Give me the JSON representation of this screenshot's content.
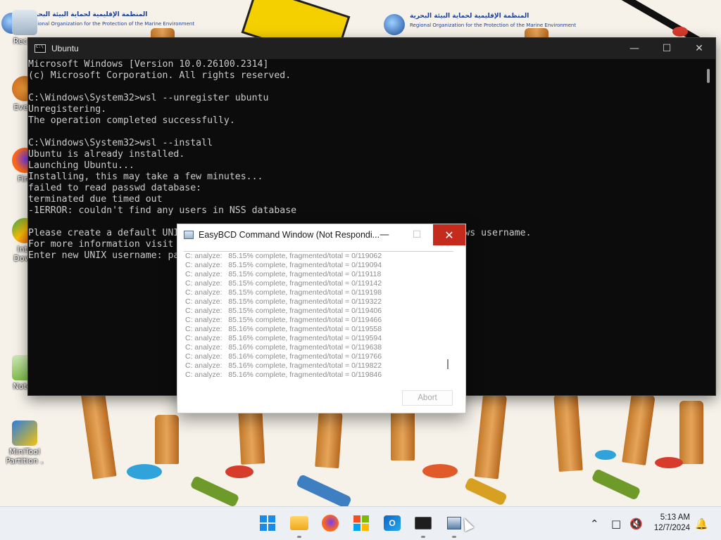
{
  "desktop": {
    "icons": [
      {
        "label": "Recyc",
        "name": "recycle-bin"
      },
      {
        "label": "Every",
        "name": "everything"
      },
      {
        "label": "Fire",
        "name": "firefox"
      },
      {
        "label": "Inte\nDown",
        "name": "internet-download-manager"
      },
      {
        "label": "Notep",
        "name": "notepad-plus-plus"
      },
      {
        "label": "MiniTool\nPartition ...",
        "name": "minitool-partition-wizard"
      }
    ]
  },
  "console": {
    "title": "Ubuntu",
    "lines": [
      "Microsoft Windows [Version 10.0.26100.2314]",
      "(c) Microsoft Corporation. All rights reserved.",
      "",
      "C:\\Windows\\System32>wsl --unregister ubuntu",
      "Unregistering.",
      "The operation completed successfully.",
      "",
      "C:\\Windows\\System32>wsl --install",
      "Ubuntu is already installed.",
      "Launching Ubuntu...",
      "Installing, this may take a few minutes...",
      "failed to read passwd database:",
      "terminated due timed out",
      "-1ERROR: couldn't find any users in NSS database",
      "",
      "Please create a default UNI                                         your Windows username.",
      "For more information visit",
      "Enter new UNIX username: pa"
    ]
  },
  "easybcd": {
    "title": "EasyBCD Command Window (Not Respondi...",
    "log": [
      "C: analyze:   85.15% complete, fragmented/total = 0/119062",
      "C: analyze:   85.15% complete, fragmented/total = 0/119094",
      "C: analyze:   85.15% complete, fragmented/total = 0/119118",
      "C: analyze:   85.15% complete, fragmented/total = 0/119142",
      "C: analyze:   85.15% complete, fragmented/total = 0/119198",
      "C: analyze:   85.15% complete, fragmented/total = 0/119322",
      "C: analyze:   85.15% complete, fragmented/total = 0/119406",
      "C: analyze:   85.15% complete, fragmented/total = 0/119466",
      "C: analyze:   85.16% complete, fragmented/total = 0/119558",
      "C: analyze:   85.16% complete, fragmented/total = 0/119594",
      "C: analyze:   85.16% complete, fragmented/total = 0/119638",
      "C: analyze:   85.16% complete, fragmented/total = 0/119766",
      "C: analyze:   85.16% complete, fragmented/total = 0/119822",
      "C: analyze:   85.16% complete, fragmented/total = 0/119846"
    ],
    "abort_label": "Abort"
  },
  "taskbar": {
    "apps": [
      "start",
      "file-explorer",
      "firefox",
      "microsoft-store",
      "outlook",
      "terminal",
      "easybcd"
    ],
    "clock": {
      "time": "5:13 AM",
      "date": "12/7/2024"
    },
    "tray": [
      "chevron-up-icon",
      "network-icon",
      "volume-muted-icon",
      "notification-bell-icon"
    ]
  },
  "colors": {
    "console_bg": "#0c0c0c",
    "console_text": "#cccccc",
    "close_red": "#c42b1c",
    "accent": "#1a8ce8"
  }
}
